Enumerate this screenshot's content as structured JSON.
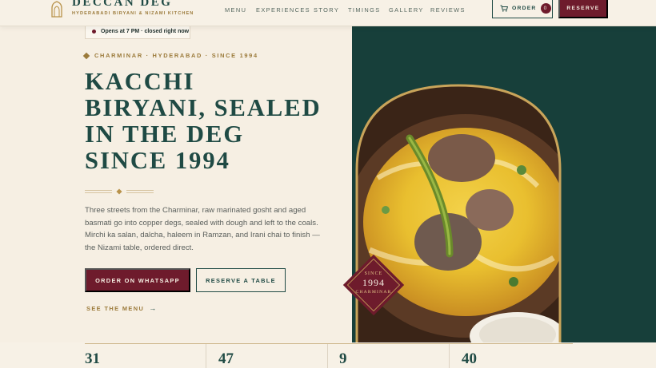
{
  "header": {
    "brand": "DECCAN DEG",
    "tagline": "HYDERABADI BIRYANI & NIZAMI KITCHEN",
    "nav": [
      "MENU",
      "EXPERIENCES",
      "STORY",
      "TIMINGS",
      "GALLERY",
      "REVIEWS"
    ],
    "order_label": "ORDER",
    "order_count": "0",
    "reserve_label": "RESERVE"
  },
  "status": {
    "text": "Opens at 7 PM · closed right now"
  },
  "hero": {
    "eyebrow": "CHARMINAR · HYDERABAD · SINCE 1994",
    "title_lines": [
      "KACCHI",
      "BIRYANI, SEALED",
      "IN THE DEG",
      "SINCE 1994"
    ],
    "lead": "Three streets from the Charminar, raw marinated gosht and aged basmati go into copper degs, sealed with dough and left to the coals. Mirchi ka salan, dalcha, haleem in Ramzan, and Irani chai to finish — the Nizami table, ordered direct.",
    "cta_primary": "ORDER ON WHATSAPP",
    "cta_secondary": "RESERVE A TABLE",
    "menu_link": "SEE THE MENU",
    "menu_arrow": "→"
  },
  "seal": {
    "top": "SINCE",
    "year": "1994",
    "bottom": "CHARMINAR"
  },
  "stats": [
    "31",
    "47",
    "9",
    "40"
  ],
  "colors": {
    "green": "#173f3a",
    "maroon": "#6e1b2c",
    "gold": "#9b7a3a",
    "cream": "#f6efe3"
  }
}
